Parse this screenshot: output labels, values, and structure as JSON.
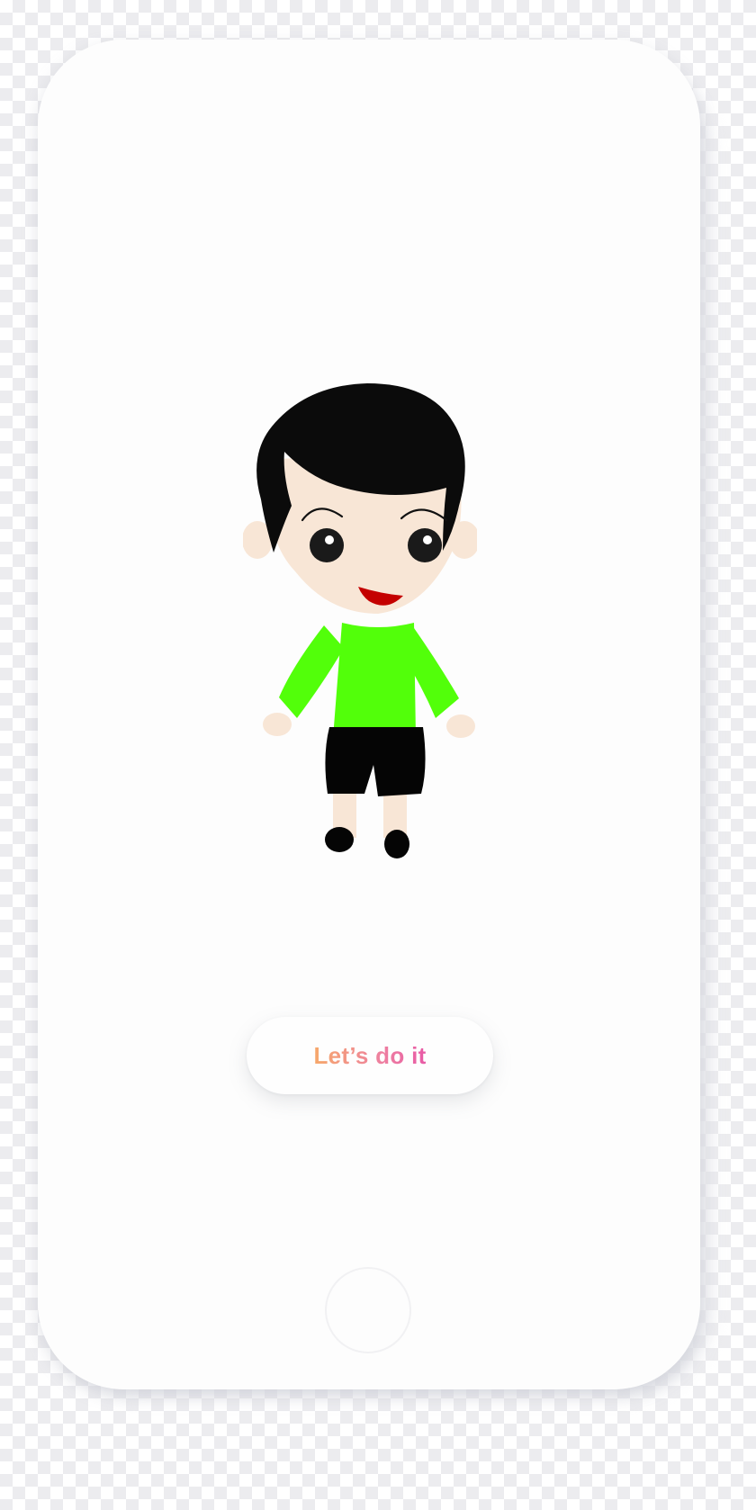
{
  "cta": {
    "label": "Let’s do it"
  },
  "mascot": {
    "icon": "cartoon-boy-icon",
    "colors": {
      "hair": "#0b0b0b",
      "skin": "#f8e6d6",
      "shirt": "#52ff0a",
      "shorts": "#050505",
      "mouth": "#c40000"
    }
  },
  "theme": {
    "cta_gradient_start": "#f6a96a",
    "cta_gradient_end": "#e85aa6"
  }
}
